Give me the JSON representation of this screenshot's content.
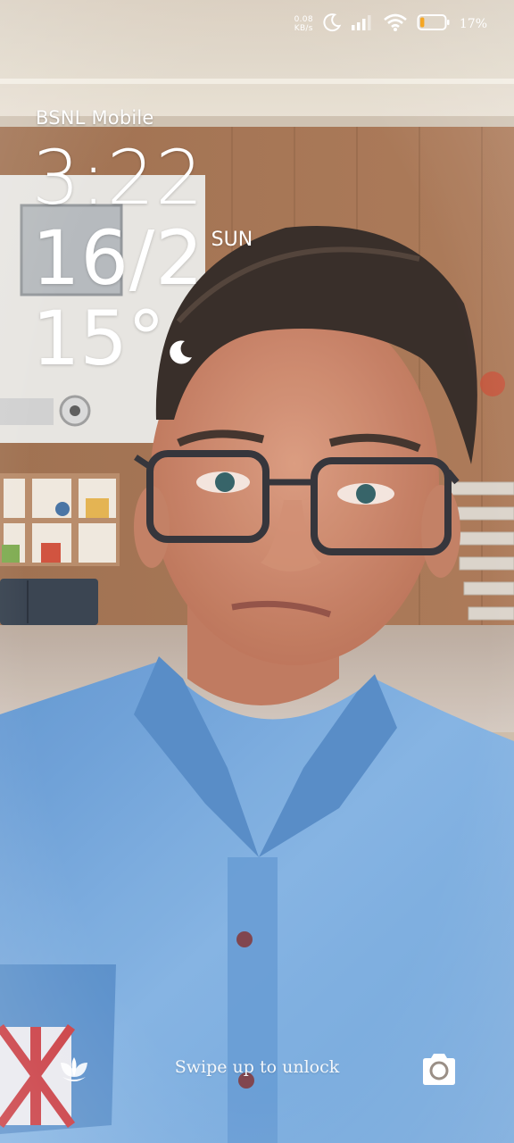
{
  "status_bar": {
    "net_speed_value": "0.08",
    "net_speed_unit": "KB/s",
    "icons": [
      "moon-icon",
      "signal-icon",
      "wifi-icon",
      "battery-icon"
    ],
    "battery_percent": "17%",
    "battery_level": 0.17,
    "battery_color": "#f5a623"
  },
  "lock_screen": {
    "carrier": "BSNL Mobile",
    "time": "3:22",
    "date": "16/2",
    "weekday": "SUN",
    "temperature": "15°",
    "weather_icon": "crescent-moon-icon"
  },
  "bottom": {
    "left_shortcut_icon": "leaf-icon",
    "swipe_hint": "Swipe up to unlock",
    "right_shortcut_icon": "camera-icon"
  }
}
